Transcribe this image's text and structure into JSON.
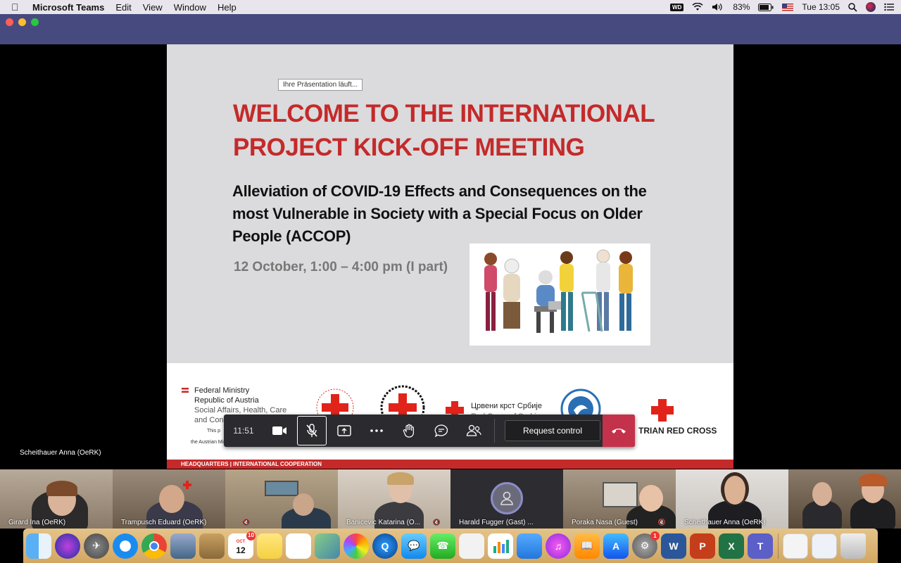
{
  "menubar": {
    "app_name": "Microsoft Teams",
    "items": [
      "Edit",
      "View",
      "Window",
      "Help"
    ],
    "wd_label": "WD",
    "battery": "83%",
    "clock": "Tue 13:05"
  },
  "slide": {
    "presentation_notice": "Ihre Präsentation läuft...",
    "title": "WELCOME TO THE INTERNATIONAL PROJECT KICK-OFF MEETING",
    "subtitle": "Alleviation of COVID-19 Effects and Consequences on the most Vulnerable in Society with a Special Focus on Older People (ACCOP)",
    "date": "12 October, 1:00 – 4:00 pm (I part)",
    "ministry": {
      "line1": "Federal Ministry",
      "line2": "Republic of Austria",
      "line3": "Social Affairs, Health, Care",
      "line4": "and Consumer Protection",
      "note1": "This p",
      "note2": "the Austrian Ministry of Social Aff"
    },
    "serbia_line1": "Црвени крст Србије",
    "serbia_line2": "Red Cross of Serbia",
    "austrian_rc": "TRIAN RED CROSS",
    "footer_band": "HEADQUARTERS | INTERNATIONAL COOPERATION"
  },
  "speaker_label": "Scheithauer Anna (OeRK)",
  "controls": {
    "timer": "11:51",
    "request_control": "Request control"
  },
  "participants": [
    {
      "name": "Girard Ina (OeRK)"
    },
    {
      "name": "Trampusch Eduard (OeRK)"
    },
    {
      "name": ""
    },
    {
      "name": "Banicevic Katarina (O..."
    },
    {
      "name": "Harald Fugger (Gast) ..."
    },
    {
      "name": "Poraka Nasa (Guest)"
    },
    {
      "name": "Scheithauer Anna (OeRK)"
    },
    {
      "name": ""
    }
  ],
  "dock": {
    "calendar_month": "OCT",
    "calendar_day": "12",
    "calendar_badge": "10",
    "settings_badge": "1"
  },
  "colors": {
    "teams_titlebar": "#474a7f",
    "slide_red": "#c42a2a",
    "hangup": "#c4314b"
  }
}
